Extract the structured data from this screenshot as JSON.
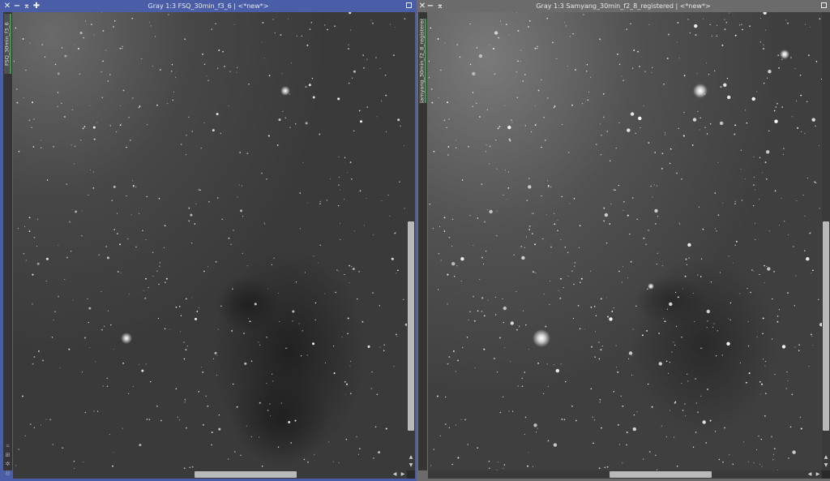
{
  "window_left": {
    "title": "Gray 1:3 FSQ_30min_f3_6 | <*new*>",
    "tab_label": "FSQ_30min_f3_6",
    "controls": {
      "close": "✕",
      "minimize": "−",
      "shade": "⌅",
      "pin": "✚"
    },
    "image_description": "Narrowband grayscale astro image: dense star field with nebulosity on the upper left and a dark nebula in the lower center",
    "accent_color": "#4a5ea8"
  },
  "window_right": {
    "title": "Gray 1:3 Samyang_30min_f2_8_registered | <*new*>",
    "tab_label": "Samyang_30min_f2_8_registered",
    "controls": {
      "close": "✕",
      "minimize": "−",
      "shade": "⌅"
    },
    "image_description": "Same field captured with different optics, registered; brighter stars and more contrast",
    "accent_color": "#6b6b6b"
  },
  "side_icons": [
    "pin-icon",
    "grid-icon",
    "gear-icon",
    "circle-icon"
  ],
  "scroll": {
    "left_arrow": "◀",
    "right_arrow": "▶",
    "up_arrow": "▲",
    "down_arrow": "▼"
  }
}
